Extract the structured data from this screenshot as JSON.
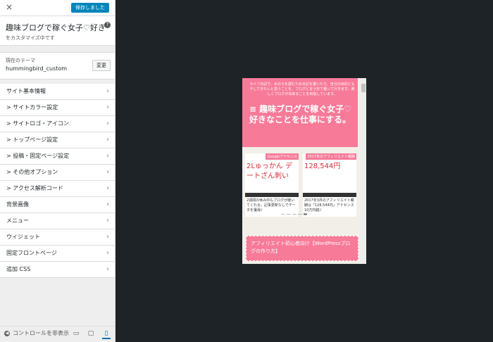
{
  "topbar": {
    "close_icon": "×",
    "saved_label": "保存しました"
  },
  "info": {
    "site_title": "趣味ブログで稼ぐ女子♡好き",
    "subtitle": "をカスタマイズ中です",
    "help_icon": "?"
  },
  "theme": {
    "label": "現在のテーマ",
    "name": "hummingbird_custom",
    "change_label": "変更"
  },
  "menu": [
    {
      "label": "サイト基本情報"
    },
    {
      "label": "> サイトカラー設定"
    },
    {
      "label": "> サイトロゴ・アイコン"
    },
    {
      "label": "> トップページ設定"
    },
    {
      "label": "> 投稿・固定ページ設定"
    },
    {
      "label": "> その他オプション"
    },
    {
      "label": "> アクセス解析コード"
    },
    {
      "label": "背景画像"
    },
    {
      "label": "メニュー"
    },
    {
      "label": "ウィジェット"
    },
    {
      "label": "固定フロントページ"
    },
    {
      "label": "追加 CSS"
    }
  ],
  "footer": {
    "hide_label": "コントロールを非表示"
  },
  "preview": {
    "desc": "ライフ日記で、めのらを読むため日記を書いたり、自分の目的ともやしてきたいと思うことを、ブログと言う形で書いて行きます。楽しくブログが出来ることを目指しています。",
    "title": "≡ 趣味ブログで稼ぐ女子♡好きなことを仕事にする。",
    "card1": {
      "tag": "Googleアドセンス",
      "hand": "2Lゅっかん デートざん刺い",
      "cap": "2週間の休み中もブログが継いてくれる。記事更新なしでデータを獲得♪"
    },
    "card2": {
      "tag": "2017年のアフィリエイト報酬",
      "hand": "128,544円",
      "cap": "2017年3月のアフィリエイト報酬は「128,544円」アドセンス10万円越♪"
    },
    "bottom": "アフィリエイト初心者向け【WordPressブログの作り方】"
  }
}
